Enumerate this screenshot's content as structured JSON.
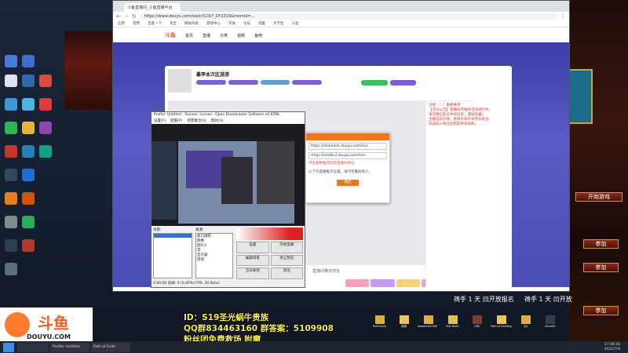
{
  "browser": {
    "tab_title": "斗鱼直播间_斗鱼直播平台",
    "url": "https://www.douyu.com/topic/S19/?_DY2019&roomid=...",
    "bookmarks": [
      "应用",
      "常用",
      "百度一下",
      "淘宝",
      "网站导航",
      "游戏中心",
      "开发",
      "论坛",
      "优酷",
      "大学生",
      "斗鱼"
    ]
  },
  "site": {
    "logo": "斗鱼",
    "nav": [
      "首页",
      "直播",
      "分类",
      "视频",
      "鱼吧"
    ],
    "room_title": "暴李本次区游游",
    "sidepanel_lines": [
      "注意！！！重要事项",
      "【活动公告】直播间内抽奖活动进行中，",
      "请勿相信私信中奖信息，谨防诈骗！",
      "主播当前在线，感谢大家的支持与关注，",
      "欢迎加入粉丝团获取更多福利。"
    ],
    "msgbox_input1": "https://sharelink.douyu.com/live",
    "msgbox_input2": "rtmp://sendtc3.douyu.com/live",
    "msgbox_link": "点击复制推流码及直播间地址",
    "msgbox_note": "以下为直播推流设置，请勿泄露给他人。",
    "msgbox_button": "确定",
    "footer_text": "直播间推流地址"
  },
  "obs": {
    "title": "Profile: Untitled - Scenes: scenes - Open Broadcaster Software v0.659b",
    "menu": [
      "设置(F)",
      "配置(P)",
      "场景集合(S)",
      "帮助(H)"
    ],
    "scenes_label": "场景:",
    "sources_label": "来源:",
    "sources": [
      "窗口捕获",
      "图像",
      "图片2",
      "音",
      "显示器",
      "游戏"
    ],
    "buttons": [
      "设置",
      "开始直播",
      "编辑场景",
      "停止预览",
      "全局来源",
      "退出"
    ],
    "status": "0:00:00   丢帧: 0 (0.00%)   FPS: 30   0kb/s"
  },
  "game": {
    "btn_start": "开始游戏",
    "btn_join": [
      "参加",
      "参加",
      "参加"
    ],
    "wish": [
      "祷手 1 天 凹开放报名",
      "祷手 1 天 凹开放"
    ]
  },
  "overlay": {
    "line1": "ID：S19圣光蜗牛贵族",
    "line2": "QQ群834463160 群答案：5109908",
    "line3": "粉丝团免费救场 附魔"
  },
  "douyu_logo": {
    "name": "斗鱼",
    "domain": "DOUYU.COM"
  },
  "taskbar": {
    "items": [
      "Profile: Untitled",
      "Path of Exile"
    ],
    "clock_time": "17:48:56",
    "clock_date": "2022/7/9"
  },
  "desktop_icons": [
    "此电脑",
    "回收站",
    "网络",
    "Steam",
    "浏览器",
    "网易云",
    "Path of Exile"
  ],
  "tray_apps": [
    "PoeCharm",
    "视频",
    "Awakened PoE Trade",
    "PoE Build",
    "OBS",
    "Path of Building",
    "QQ",
    "VisualSt"
  ],
  "colors": {
    "accent": "#ff5d23",
    "overlay_text": "#f6ec52",
    "purple": "#4c4cb5"
  }
}
